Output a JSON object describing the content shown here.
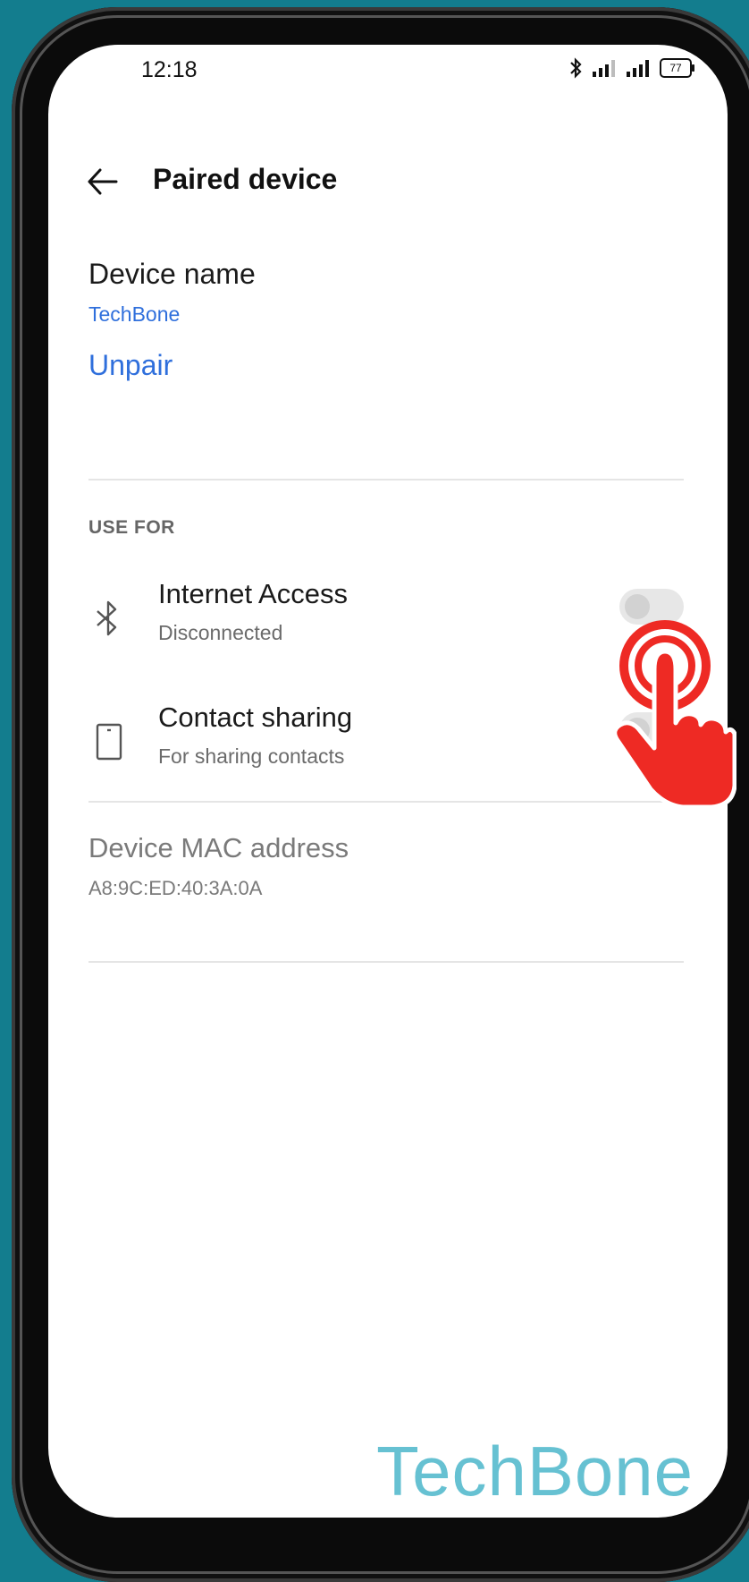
{
  "status_bar": {
    "time": "12:18",
    "battery": "77"
  },
  "header": {
    "title": "Paired device"
  },
  "device_name": {
    "label": "Device name",
    "value": "TechBone"
  },
  "actions": {
    "unpair": "Unpair"
  },
  "use_for": {
    "section_label": "USE FOR",
    "items": [
      {
        "title": "Internet Access",
        "subtitle": "Disconnected",
        "icon": "bluetooth-icon",
        "enabled": false
      },
      {
        "title": "Contact sharing",
        "subtitle": "For sharing contacts",
        "icon": "phone-icon",
        "enabled": false
      }
    ]
  },
  "mac": {
    "label": "Device MAC address",
    "value": "A8:9C:ED:40:3A:0A"
  },
  "watermark": "TechBone",
  "colors": {
    "background": "#137d8e",
    "accent": "#2f6fdc",
    "hand": "#ee2a24",
    "watermark": "#66c1d2"
  }
}
